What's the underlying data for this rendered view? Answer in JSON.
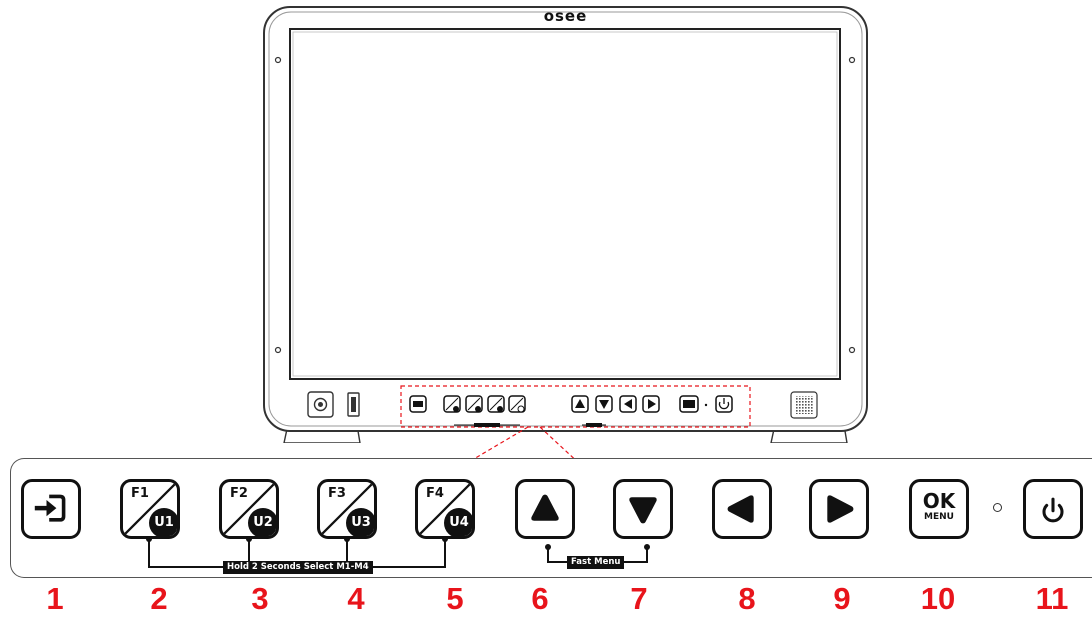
{
  "monitor": {
    "brand": "osee"
  },
  "controls": {
    "input_icon": "input-source-icon",
    "f_keys": [
      {
        "f": "F1",
        "u": "U1"
      },
      {
        "f": "F2",
        "u": "U2"
      },
      {
        "f": "F3",
        "u": "U3"
      },
      {
        "f": "F4",
        "u": "U4"
      }
    ],
    "arrows": [
      "up-arrow-icon",
      "down-arrow-icon",
      "left-arrow-icon",
      "right-arrow-icon"
    ],
    "ok_key": {
      "main": "OK",
      "sub": "MENU"
    },
    "power_icon": "power-icon",
    "hold_label": "Hold 2 Seconds Select M1-M4",
    "fast_menu_label": "Fast Menu"
  },
  "callouts": [
    "1",
    "2",
    "3",
    "4",
    "5",
    "6",
    "7",
    "8",
    "9",
    "10",
    "11"
  ],
  "colors": {
    "callout": "#e8141b",
    "outline": "#111111",
    "zoom_dash": "#e8141b"
  }
}
